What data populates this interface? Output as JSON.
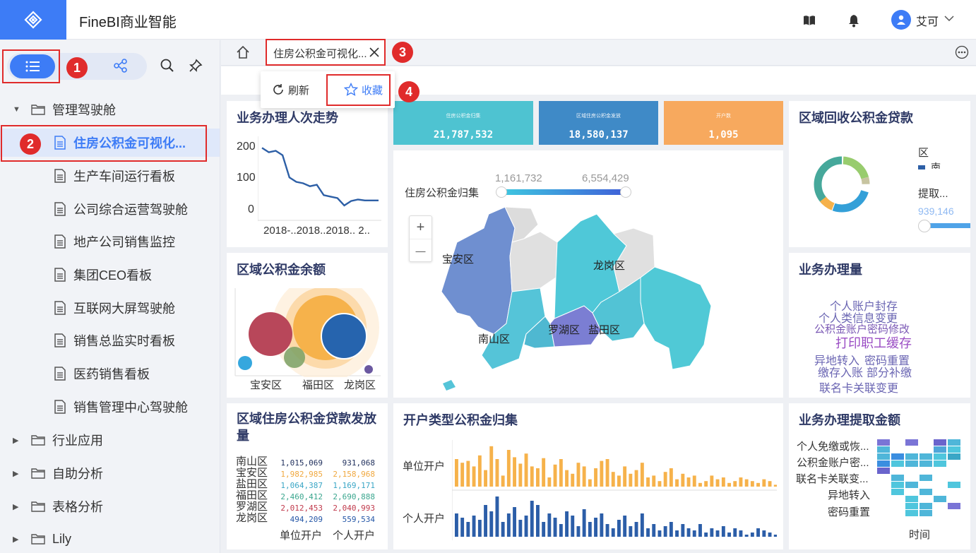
{
  "app": {
    "title": "FineBI商业智能",
    "user": "艾可"
  },
  "sidebar": {
    "folders": [
      {
        "label": "管理驾驶舱",
        "expanded": true
      },
      {
        "label": "行业应用"
      },
      {
        "label": "自助分析"
      },
      {
        "label": "表格分析"
      },
      {
        "label": "Lily"
      }
    ],
    "reports": [
      "住房公积金可视化...",
      "生产车间运行看板",
      "公司综合运营驾驶舱",
      "地产公司销售监控",
      "集团CEO看板",
      "互联网大屏驾驶舱",
      "销售总监实时看板",
      "医药销售看板",
      "销售管理中心驾驶舱"
    ]
  },
  "tab": {
    "label": "住房公积金可视化..."
  },
  "popup": {
    "refresh": "刷新",
    "favorite": "收藏"
  },
  "badges": [
    "1",
    "2",
    "3",
    "4"
  ],
  "cards": {
    "trend": {
      "title": "业务办理人次走势",
      "yticks": [
        "200",
        "100",
        "0"
      ],
      "xlabel": "2018-..2018..2018.. 2.."
    },
    "balance": {
      "title": "区域公积金余额",
      "xticks": [
        "宝安区",
        "福田区",
        "龙岗区"
      ]
    },
    "loan": {
      "title": "区域住房公积金贷款发放量"
    },
    "kpi": [
      {
        "label": "住房公积金归集",
        "value": "21,787,532",
        "color": "#4ec3d1"
      },
      {
        "label": "区域住房公积金发放",
        "value": "18,580,137",
        "color": "#3f8ac7"
      },
      {
        "label": "开户数",
        "value": "1,095",
        "color": "#f7a95e"
      }
    ],
    "map": {
      "legend_label": "住房公积金归集",
      "min": "1,161,732",
      "max": "6,554,429",
      "zoom_in": "+",
      "zoom_out": "—",
      "regions": [
        "宝安区",
        "龙岗区",
        "南山区",
        "罗湖区",
        "盐田区"
      ]
    },
    "donut": {
      "title": "区域回收公积金贷款",
      "legend_title": "区",
      "legend_item": "南",
      "legend_title2": "提取...",
      "slider_value": "939,146"
    },
    "wordcloud": {
      "title": "业务办理量",
      "words": [
        "个人账户封存",
        "个人类信息变更",
        "公积金账户密码修改",
        "打印职工缓存",
        "异地转入",
        "密码重置",
        "缴存入账",
        "部分补缴",
        "联名卡关联变更"
      ]
    },
    "account": {
      "title": "开户类型公积金归集",
      "rows": [
        "单位开户",
        "个人开户"
      ]
    },
    "heatmap": {
      "title": "业务办理提取金额",
      "rows": [
        "个人免缴或恢...",
        "公积金账户密...",
        "联名卡关联变...",
        "异地转入",
        "密码重置"
      ],
      "xlabel": "时间"
    }
  },
  "table": {
    "rows": [
      {
        "region": "南山区",
        "a": "1,015,069",
        "b": "931,068",
        "color": "#1f2f5c"
      },
      {
        "region": "宝安区",
        "a": "1,982,985",
        "b": "2,158,968",
        "color": "#f0a83f"
      },
      {
        "region": "盐田区",
        "a": "1,064,387",
        "b": "1,169,171",
        "color": "#3aa6c6"
      },
      {
        "region": "福田区",
        "a": "2,460,412",
        "b": "2,690,888",
        "color": "#3aa68e"
      },
      {
        "region": "罗湖区",
        "a": "2,012,453",
        "b": "2,040,993",
        "color": "#c0394b"
      },
      {
        "region": "龙岗区",
        "a": "494,209",
        "b": "559,534",
        "color": "#2557a7"
      }
    ],
    "cols": [
      "单位开户",
      "个人开户"
    ]
  },
  "chart_data": [
    {
      "type": "line",
      "title": "业务办理人次走势",
      "x": [
        "2018-..",
        "2018..",
        "2018..",
        "2.."
      ],
      "yticks": [
        0,
        100,
        200
      ],
      "values": [
        200,
        185,
        190,
        175,
        100,
        85,
        80,
        70,
        75,
        40,
        35,
        30,
        5,
        20,
        25,
        22,
        22,
        22
      ]
    },
    {
      "type": "bar",
      "title": "开户类型公积金归集",
      "series": [
        {
          "name": "单位开户"
        },
        {
          "name": "个人开户"
        }
      ]
    }
  ]
}
